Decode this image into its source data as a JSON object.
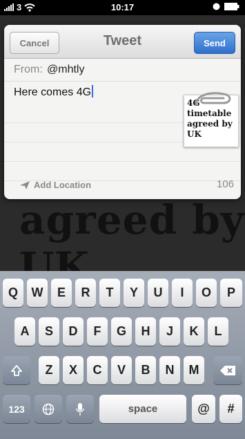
{
  "status_bar": {
    "carrier": "3",
    "time": "10:17"
  },
  "article": {
    "headline_line1": "agreed by",
    "headline_line2": "UK"
  },
  "tweet_sheet": {
    "title": "Tweet",
    "cancel_label": "Cancel",
    "send_label": "Send",
    "from_label": "From:",
    "from_value": "@mhtly",
    "body": "Here comes 4G",
    "attachment_text": "4G timetable agreed by UK",
    "add_location_label": "Add Location",
    "char_count": "106"
  },
  "keyboard": {
    "row1": [
      "Q",
      "W",
      "E",
      "R",
      "T",
      "Y",
      "U",
      "I",
      "O",
      "P"
    ],
    "row2": [
      "A",
      "S",
      "D",
      "F",
      "G",
      "H",
      "J",
      "K",
      "L"
    ],
    "row3": [
      "Z",
      "X",
      "C",
      "V",
      "B",
      "N",
      "M"
    ],
    "numbers_label": "123",
    "space_label": "space",
    "at_label": "@",
    "hash_label": "#"
  },
  "icons": [
    "signal-bars-icon",
    "wifi-icon",
    "alarm-icon",
    "battery-icon",
    "location-arrow-icon",
    "paperclip-icon",
    "shift-icon",
    "backspace-icon",
    "globe-icon",
    "microphone-icon"
  ]
}
